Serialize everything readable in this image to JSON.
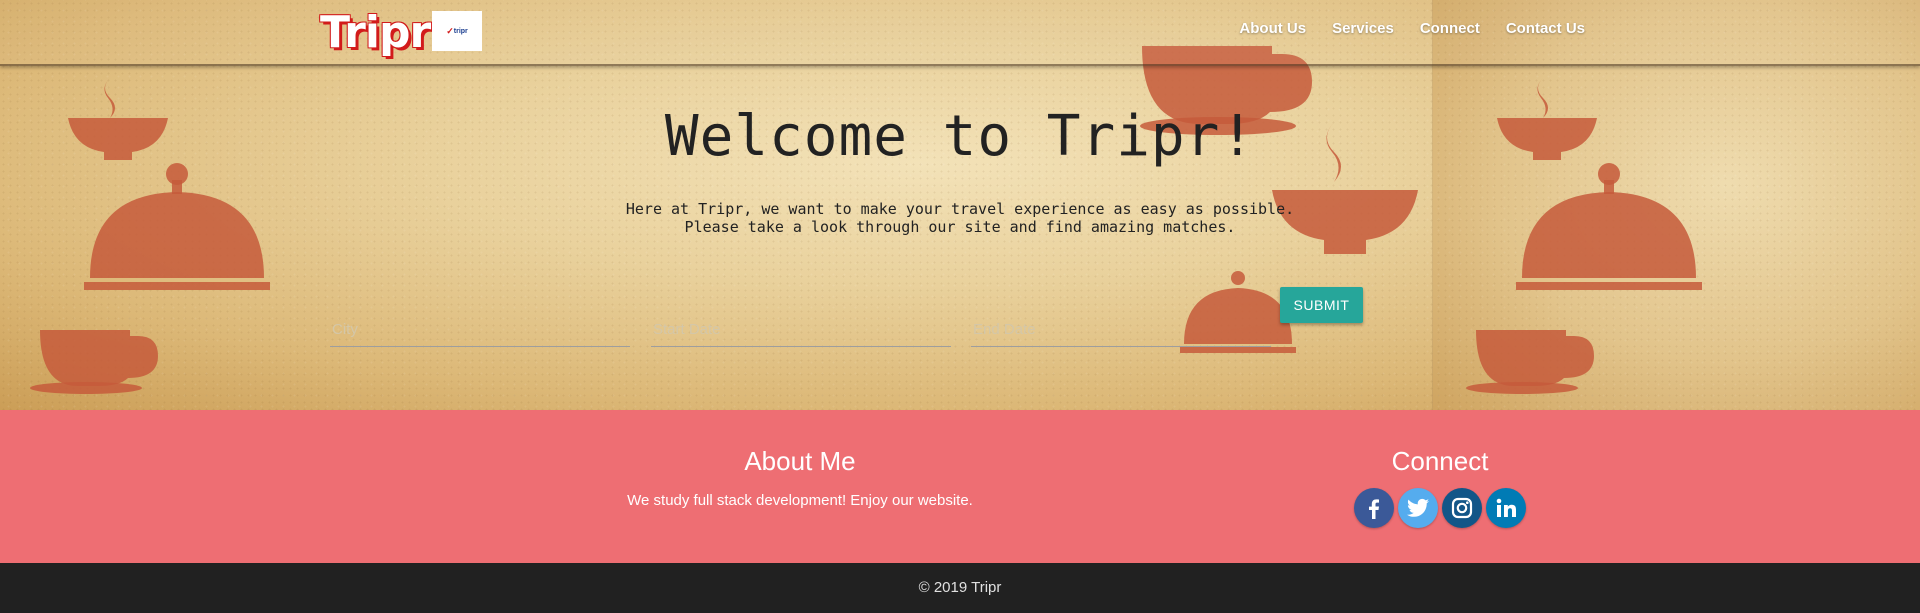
{
  "nav": {
    "brand": "Tripr",
    "logo_text": "tripr",
    "links": [
      "About Us",
      "Services",
      "Connect",
      "Contact Us"
    ]
  },
  "hero": {
    "headline": "Welcome to Tripr!",
    "tagline_line1": "Here at Tripr, we want to make your travel experience as easy as possible.",
    "tagline_line2": "Please take a look through our site and find amazing matches."
  },
  "search_form": {
    "city_placeholder": "City",
    "start_placeholder": "Start Date",
    "end_placeholder": "End Date",
    "submit_label": "SUBMIT"
  },
  "footer": {
    "about_title": "About Me",
    "about_text": "We study full stack development! Enjoy our website.",
    "connect_title": "Connect",
    "socials": [
      {
        "name": "facebook-icon",
        "color": "#3b5998"
      },
      {
        "name": "twitter-icon",
        "color": "#55acee"
      },
      {
        "name": "instagram-icon",
        "color": "#125688"
      },
      {
        "name": "linkedin-icon",
        "color": "#007bb5"
      }
    ],
    "copyright": "© 2019 Tripr"
  },
  "colors": {
    "footer_bg": "#ee6e73",
    "bottom_bar": "#212121",
    "submit_bg": "#26a69a",
    "brand_shadow": "#d21b1b"
  }
}
